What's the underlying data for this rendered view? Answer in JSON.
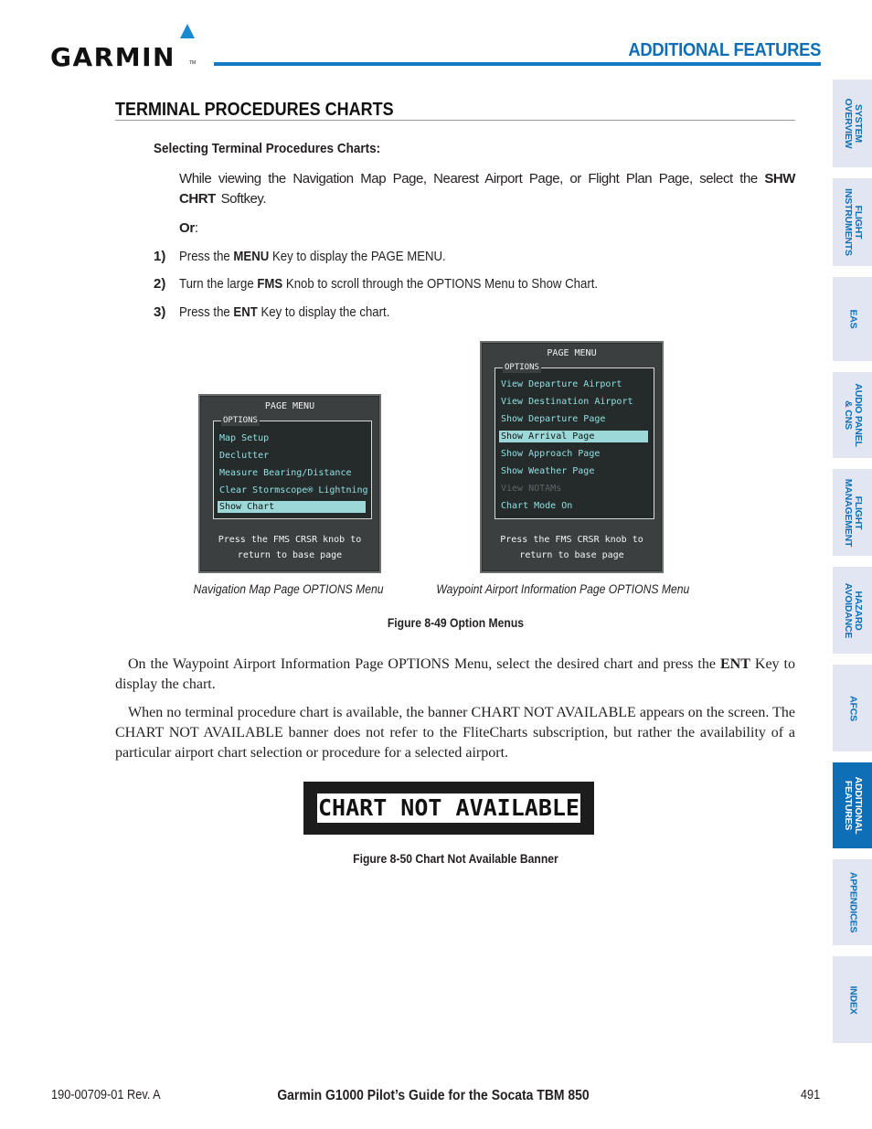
{
  "header": {
    "logo_text": "GARMIN",
    "logo_tm": "TM",
    "section_title": "ADDITIONAL FEATURES",
    "brand_color": "#0e6fb7"
  },
  "page": {
    "heading": "TERMINAL PROCEDURES CHARTS",
    "procedure_title": "Selecting Terminal Procedures Charts:",
    "intro_parts": [
      "While viewing the Navigation Map Page, Nearest Airport Page, or Flight Plan Page, select the ",
      "SHW CHRT",
      " Softkey."
    ],
    "or_label": "Or",
    "or_suffix": ":",
    "steps": [
      {
        "num": "1)",
        "pre": "Press the ",
        "key": "MENU",
        "post": " Key to display the PAGE MENU."
      },
      {
        "num": "2)",
        "pre": "Turn the large ",
        "key": "FMS",
        "post": " Knob to scroll through the OPTIONS Menu to Show Chart."
      },
      {
        "num": "3)",
        "pre": "Press the ",
        "key": "ENT",
        "post": " Key to display the chart."
      }
    ]
  },
  "figure_49": {
    "nav_menu": {
      "title": "PAGE MENU",
      "options_label": "OPTIONS",
      "items": [
        {
          "label": "Map Setup",
          "state": "normal"
        },
        {
          "label": "Declutter",
          "state": "normal"
        },
        {
          "label": "Measure Bearing/Distance",
          "state": "normal"
        },
        {
          "label": "Clear Stormscope® Lightning",
          "state": "normal"
        },
        {
          "label": "Show Chart",
          "state": "selected"
        }
      ],
      "footer_line1": "Press the FMS CRSR knob to",
      "footer_line2": "return to base page",
      "caption": "Navigation Map Page OPTIONS Menu"
    },
    "waypoint_menu": {
      "title": "PAGE MENU",
      "options_label": "OPTIONS",
      "items": [
        {
          "label": "View Departure Airport",
          "state": "normal"
        },
        {
          "label": "View Destination Airport",
          "state": "normal"
        },
        {
          "label": "Show Departure Page",
          "state": "normal"
        },
        {
          "label": "Show Arrival Page",
          "state": "selected"
        },
        {
          "label": "Show Approach Page",
          "state": "normal"
        },
        {
          "label": "Show Weather Page",
          "state": "normal"
        },
        {
          "label": "View NOTAMs",
          "state": "disabled"
        },
        {
          "label": "Chart Mode On",
          "state": "normal"
        }
      ],
      "footer_line1": "Press the FMS CRSR knob to",
      "footer_line2": "return to base page",
      "caption": "Waypoint Airport Information Page OPTIONS Menu"
    },
    "caption": "Figure 8-49  Option Menus",
    "menu_text_color": "#8fe0e0",
    "menu_highlight_color": "#9dd8d8"
  },
  "body": {
    "para1_pre": "On the Waypoint Airport Information Page OPTIONS Menu, select the desired chart and press the ",
    "para1_key": "ENT",
    "para1_post": " Key to display the chart.",
    "para2": "When no terminal procedure chart is available, the banner CHART NOT AVAILABLE appears on the screen. The CHART NOT AVAILABLE banner does not refer to the FliteCharts subscription, but rather the availability of a particular airport chart selection or procedure for a selected airport."
  },
  "figure_50": {
    "banner_text": "CHART NOT AVAILABLE",
    "caption": "Figure 8-50  Chart Not Available Banner"
  },
  "side_tabs": [
    {
      "line1": "SYSTEM",
      "line2": "OVERVIEW",
      "active": false
    },
    {
      "line1": "FLIGHT",
      "line2": "INSTRUMENTS",
      "active": false
    },
    {
      "line1": "EAS",
      "line2": "",
      "active": false
    },
    {
      "line1": "AUDIO PANEL",
      "line2": "& CNS",
      "active": false
    },
    {
      "line1": "FLIGHT",
      "line2": "MANAGEMENT",
      "active": false
    },
    {
      "line1": "HAZARD",
      "line2": "AVOIDANCE",
      "active": false
    },
    {
      "line1": "AFCS",
      "line2": "",
      "active": false
    },
    {
      "line1": "ADDITIONAL",
      "line2": "FEATURES",
      "active": true
    },
    {
      "line1": "APPENDICES",
      "line2": "",
      "active": false
    },
    {
      "line1": "INDEX",
      "line2": "",
      "active": false
    }
  ],
  "footer": {
    "doc_number": "190-00709-01  Rev. A",
    "title": "Garmin G1000 Pilot’s Guide for the Socata TBM 850",
    "page_number": "491"
  }
}
